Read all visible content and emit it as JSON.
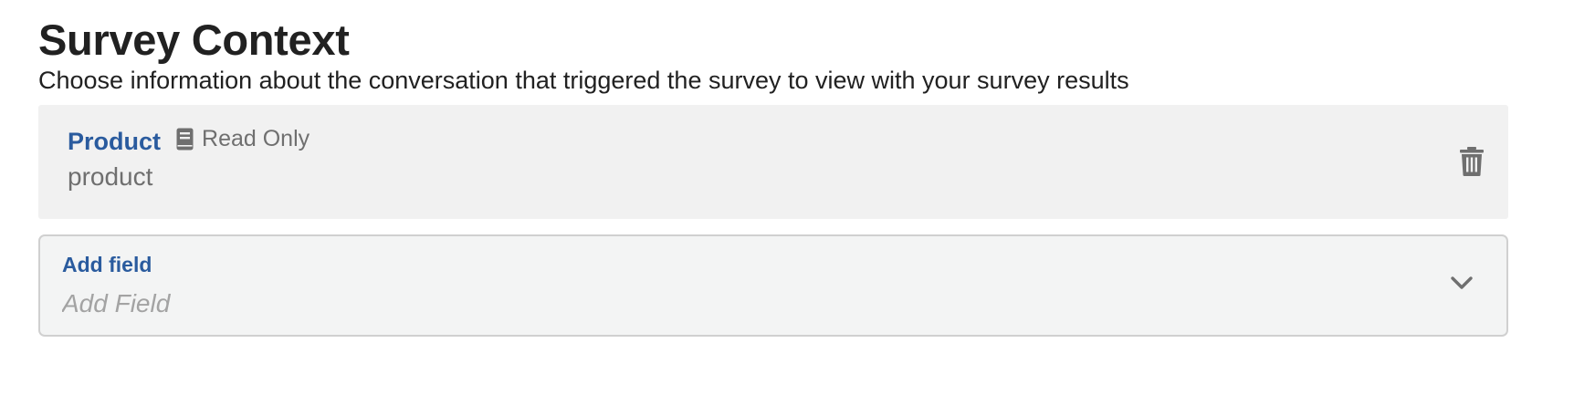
{
  "section": {
    "title": "Survey Context",
    "description": "Choose information about the conversation that triggered the survey to view with your survey results"
  },
  "fields": [
    {
      "name": "Product",
      "badge": "Read Only",
      "badge_icon": "book-icon",
      "key": "product",
      "action_icon": "trash-icon"
    }
  ],
  "add_field": {
    "label": "Add field",
    "placeholder": "Add Field",
    "icon": "chevron-down-icon"
  },
  "colors": {
    "accent": "#2a5b9e",
    "muted_text": "#6f6f6f",
    "card_bg": "#f1f1f1",
    "dropdown_bg": "#f3f4f4",
    "dropdown_border": "#d0d0d0"
  }
}
